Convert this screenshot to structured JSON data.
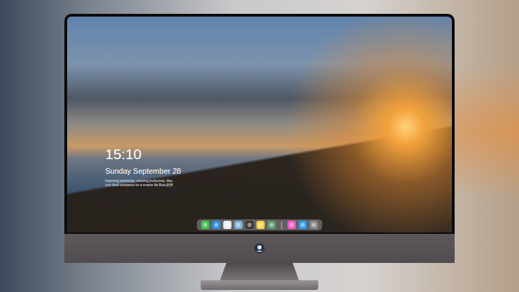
{
  "lock_screen": {
    "time": "15:10",
    "date": "Sunday September 28",
    "tagline": [
      "Improving technology, ensuring productivity. Mac,",
      "your ideal companion for a smarter life.Boss直聘"
    ]
  },
  "dock": {
    "items": [
      {
        "kind": "app",
        "color": "#3fc44f"
      },
      {
        "kind": "app",
        "color": "#2d8ce6"
      },
      {
        "kind": "app",
        "color": "#e9eef3"
      },
      {
        "kind": "app",
        "color": "#7fb5d8"
      },
      {
        "kind": "app",
        "color": "#3a3a3a"
      },
      {
        "kind": "app",
        "color": "#f5d34a"
      },
      {
        "kind": "app",
        "color": "#5d9c6e"
      },
      {
        "kind": "divider",
        "color": "#ffffff"
      },
      {
        "kind": "app",
        "color": "#f25cc0"
      },
      {
        "kind": "app",
        "color": "#2f9bf0"
      },
      {
        "kind": "app",
        "color": "#8a8a8a"
      }
    ]
  }
}
